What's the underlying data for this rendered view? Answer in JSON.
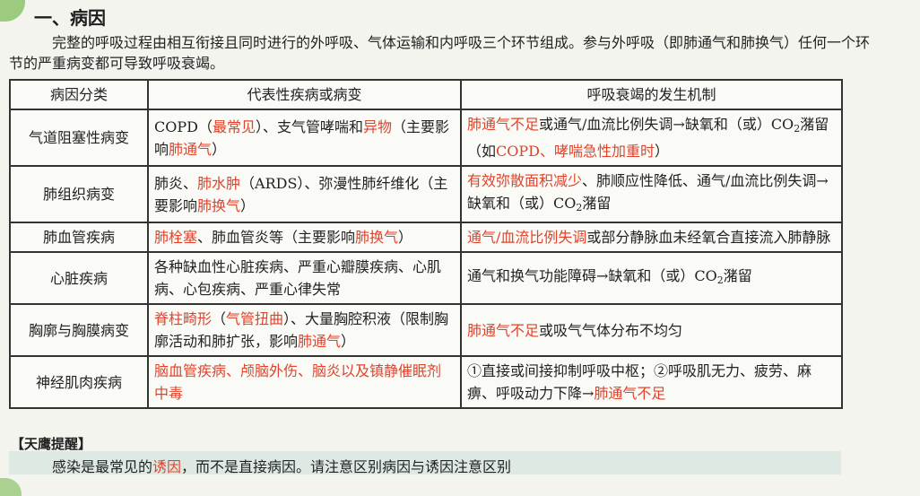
{
  "heading": "一、病因",
  "intro": "完整的呼吸过程由相互衔接且同时进行的外呼吸、气体运输和内呼吸三个环节组成。参与外呼吸（即肺通气和肺换气）任何一个环节的严重病变都可导致呼吸衰竭。",
  "table": {
    "headers": [
      "病因分类",
      "代表性疾病或病变",
      "呼吸衰竭的发生机制"
    ],
    "rows": [
      {
        "category": "气道阻塞性病变",
        "disease": [
          {
            "t": "COPD（"
          },
          {
            "t": "最常见",
            "red": true
          },
          {
            "t": "）、支气管哮喘和"
          },
          {
            "t": "异物",
            "red": true
          },
          {
            "t": "（主要影响"
          },
          {
            "t": "肺通气",
            "red": true
          },
          {
            "t": "）"
          }
        ],
        "mechanism": [
          {
            "t": "肺通气不足",
            "red": true
          },
          {
            "t": "或通气/血流比例失调→缺氧和（或）CO"
          },
          {
            "t": "2",
            "sub": true
          },
          {
            "t": "潴留（如"
          },
          {
            "t": "COPD、哮喘急性加重时",
            "red": true
          },
          {
            "t": "）"
          }
        ]
      },
      {
        "category": "肺组织病变",
        "disease": [
          {
            "t": "肺炎、"
          },
          {
            "t": "肺水肿",
            "red": true
          },
          {
            "t": "（ARDS）、弥漫性肺纤维化（主要影响"
          },
          {
            "t": "肺换气",
            "red": true
          },
          {
            "t": "）"
          }
        ],
        "mechanism": [
          {
            "t": "有效弥散面积减少",
            "red": true
          },
          {
            "t": "、肺顺应性降低、通气/血流比例失调→缺氧和（或）CO"
          },
          {
            "t": "2",
            "sub": true
          },
          {
            "t": "潴留"
          }
        ]
      },
      {
        "category": "肺血管疾病",
        "disease": [
          {
            "t": "肺栓塞",
            "red": true
          },
          {
            "t": "、肺血管炎等（主要影响"
          },
          {
            "t": "肺换气",
            "red": true
          },
          {
            "t": "）"
          }
        ],
        "mechanism": [
          {
            "t": "通气/血流比例失调",
            "red": true
          },
          {
            "t": "或部分静脉血未经氧合直接流入肺静脉"
          }
        ]
      },
      {
        "category": "心脏疾病",
        "disease": [
          {
            "t": "各种缺血性心脏疾病、严重心瓣膜疾病、心肌病、心包疾病、严重心律失常"
          }
        ],
        "mechanism": [
          {
            "t": "通气和换气功能障碍→缺氧和（或）CO"
          },
          {
            "t": "2",
            "sub": true
          },
          {
            "t": "潴留"
          }
        ]
      },
      {
        "category": "胸廓与胸膜病变",
        "disease": [
          {
            "t": "脊柱畸形",
            "red": true
          },
          {
            "t": "（"
          },
          {
            "t": "气管扭曲",
            "red": true
          },
          {
            "t": "）、大量胸腔积液（限制胸廓活动和肺扩张，影响"
          },
          {
            "t": "肺通气",
            "red": true
          },
          {
            "t": "）"
          }
        ],
        "mechanism": [
          {
            "t": "肺通气不足",
            "red": true
          },
          {
            "t": "或吸气气体分布不均匀"
          }
        ]
      },
      {
        "category": "神经肌肉疾病",
        "disease": [
          {
            "t": "脑血管疾病、颅脑外伤、脑炎以及镇静催眠剂中毒",
            "red": true
          }
        ],
        "mechanism": [
          {
            "t": "①直接或间接抑制呼吸中枢；②呼吸肌无力、疲劳、麻痹、呼吸动力下降→"
          },
          {
            "t": "肺通气不足",
            "red": true
          }
        ]
      }
    ]
  },
  "tip": {
    "title": "【天鹰提醒】",
    "segments": [
      {
        "t": "感染是最常见的"
      },
      {
        "t": "诱因",
        "red": true
      },
      {
        "t": "，而不是直接病因。请注意区别病因与诱因注意区别"
      }
    ]
  }
}
